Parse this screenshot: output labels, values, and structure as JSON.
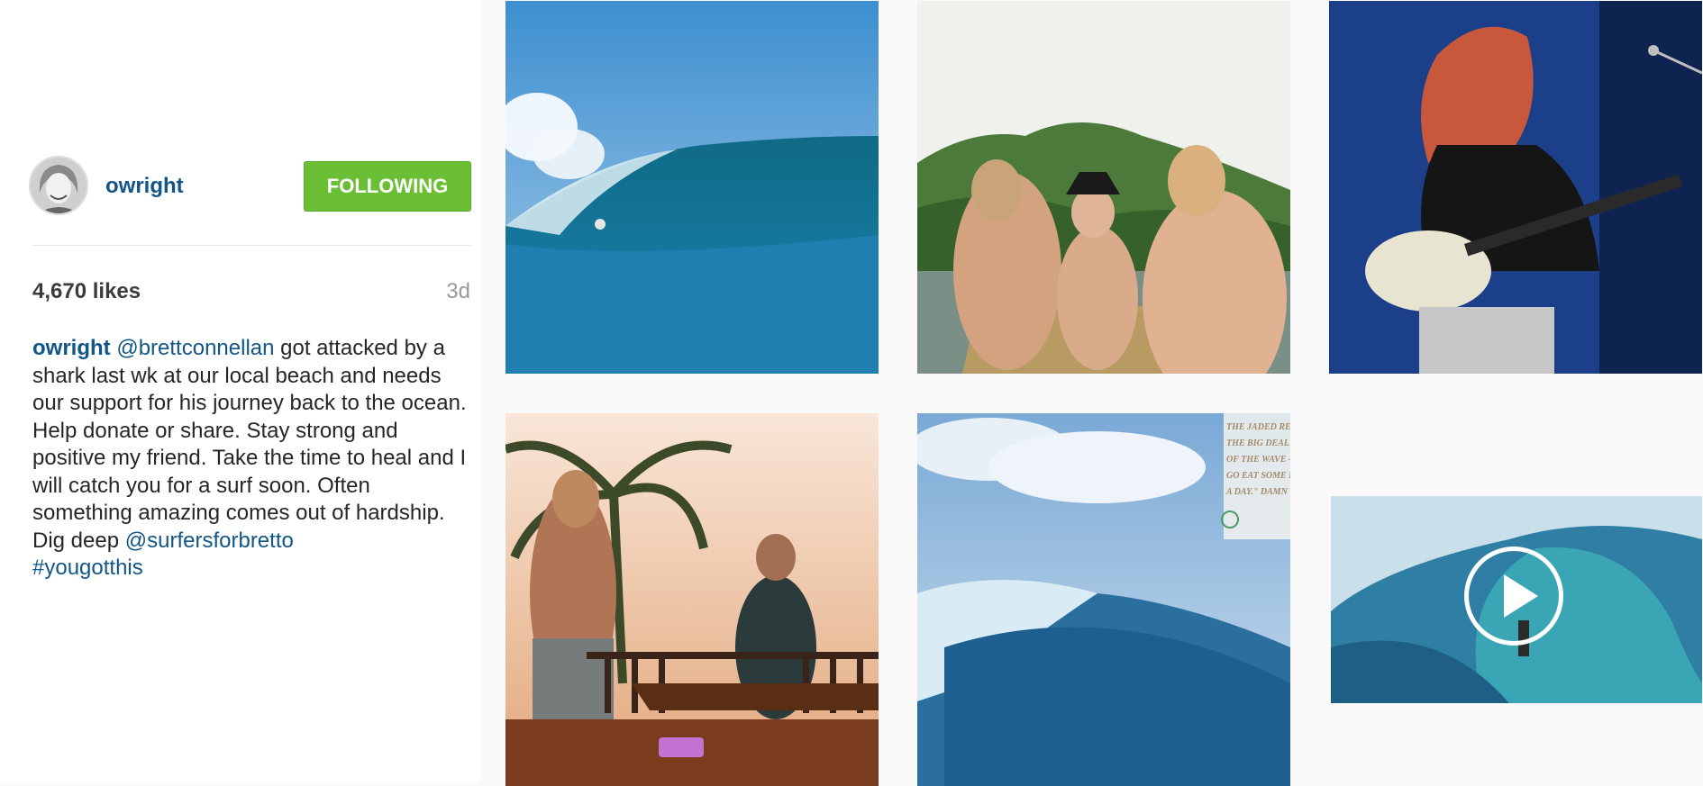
{
  "post": {
    "username": "owright",
    "follow_label": "FOLLOWING",
    "likes": "4,670 likes",
    "time": "3d"
  },
  "caption": {
    "author": "owright",
    "mention1": "@brettconnellan",
    "text1": " got attacked by a shark last wk at our local beach and needs our support for his journey back to the ocean. Help donate or share. Stay strong and positive my friend. Take the time to heal and I will catch you for a surf soon. Often something amazing comes out of hardship. Dig deep ",
    "mention2": "@surfersforbretto",
    "hashtag": "#yougotthis"
  },
  "magazine": {
    "lines": [
      "THE JADED READE",
      "THE BIG DEAL? ON",
      "OF THE WAVE —",
      "GO EAT SOME POI",
      "A DAY.\" DAMN YO"
    ]
  },
  "tiles": [
    {
      "name": "photo-wave-barrel"
    },
    {
      "name": "photo-boat-friends"
    },
    {
      "name": "photo-guitarist"
    },
    {
      "name": "photo-balcony-palm"
    },
    {
      "name": "photo-magazine-wave"
    },
    {
      "name": "video-barrel-surfer"
    }
  ]
}
